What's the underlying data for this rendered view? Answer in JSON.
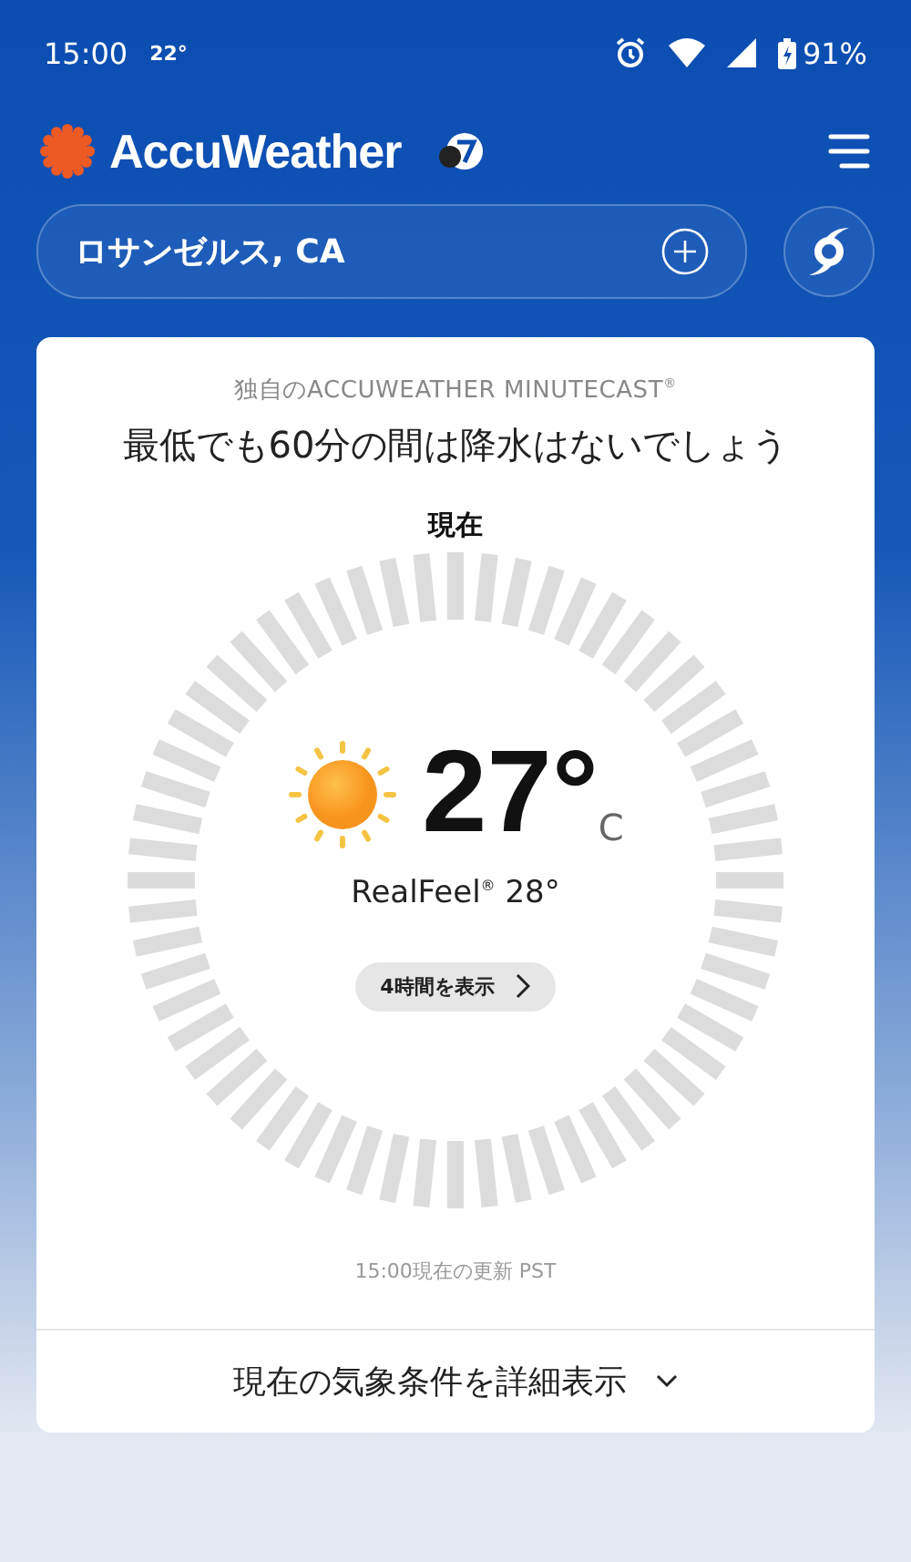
{
  "status_bar": {
    "time": "15:00",
    "temperature": "22°",
    "battery": "91%"
  },
  "header": {
    "brand": "AccuWeather",
    "location": "ロサンゼルス, CA"
  },
  "minutecast": {
    "label": "独自のACCUWEATHER MINUTECAST$^{®}$",
    "headline": "最低でも60分の間は降水はないでしょう",
    "now_label": "現在",
    "temperature": "27°",
    "unit": "C",
    "realfeel": "RealFeel$^{®}$ 28°",
    "hours_button": "4時間を表示",
    "updated": "15:00現在の更新 PST"
  },
  "details_toggle": {
    "label": "現在の気象条件を詳細表示",
    "expanded": false
  }
}
